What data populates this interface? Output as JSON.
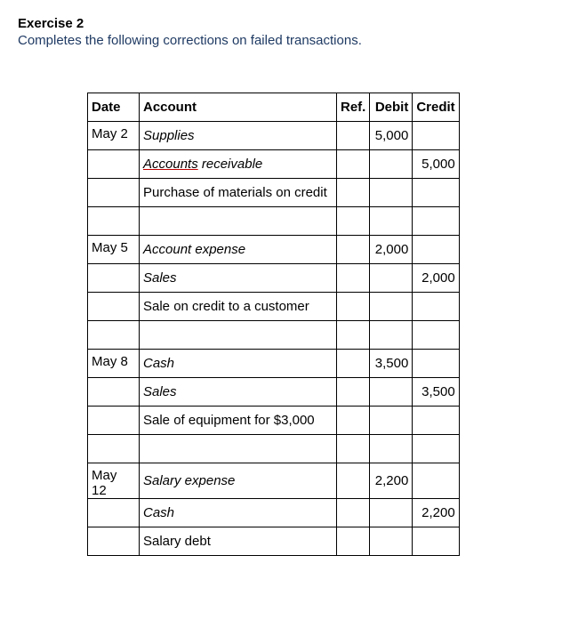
{
  "heading": {
    "title": "Exercise 2",
    "subtitle": "Completes the following corrections on failed transactions."
  },
  "headers": {
    "date": "Date",
    "account": "Account",
    "ref": "Ref.",
    "debit": "Debit",
    "credit": "Credit"
  },
  "rows": [
    {
      "date": "May 2",
      "account": "Supplies",
      "italic": true,
      "underline": false,
      "ref": "",
      "debit": "5,000",
      "credit": ""
    },
    {
      "date": "",
      "account_html": {
        "pre": "Accounts",
        "post": " receivable"
      },
      "italic": true,
      "underline_first": true,
      "ref": "",
      "debit": "",
      "credit": "5,000"
    },
    {
      "date": "",
      "account": "Purchase of materials on credit",
      "italic": false,
      "ref": "",
      "debit": "",
      "credit": ""
    },
    {
      "date": "",
      "account": "",
      "ref": "",
      "debit": "",
      "credit": ""
    },
    {
      "date": "May 5",
      "account": "Account expense",
      "italic": true,
      "ref": "",
      "debit": "2,000",
      "credit": ""
    },
    {
      "date": "",
      "account": "Sales",
      "italic": true,
      "ref": "",
      "debit": "",
      "credit": "2,000"
    },
    {
      "date": "",
      "account": "Sale on credit to a customer",
      "italic": false,
      "ref": "",
      "debit": "",
      "credit": ""
    },
    {
      "date": "",
      "account": "",
      "ref": "",
      "debit": "",
      "credit": ""
    },
    {
      "date": "May 8",
      "account": "Cash",
      "italic": true,
      "ref": "",
      "debit": "3,500",
      "credit": ""
    },
    {
      "date": "",
      "account": "Sales",
      "italic": true,
      "ref": "",
      "debit": "",
      "credit": "3,500"
    },
    {
      "date": "",
      "account": "Sale of equipment for $3,000",
      "italic": false,
      "ref": "",
      "debit": "",
      "credit": ""
    },
    {
      "date": "",
      "account": "",
      "ref": "",
      "debit": "",
      "credit": ""
    },
    {
      "date": "May 12",
      "account": "Salary expense",
      "italic": true,
      "ref": "",
      "debit": "2,200",
      "credit": ""
    },
    {
      "date": "",
      "account": "Cash",
      "italic": true,
      "ref": "",
      "debit": "",
      "credit": "2,200"
    },
    {
      "date": "",
      "account": "Salary debt",
      "italic": false,
      "ref": "",
      "debit": "",
      "credit": ""
    }
  ]
}
